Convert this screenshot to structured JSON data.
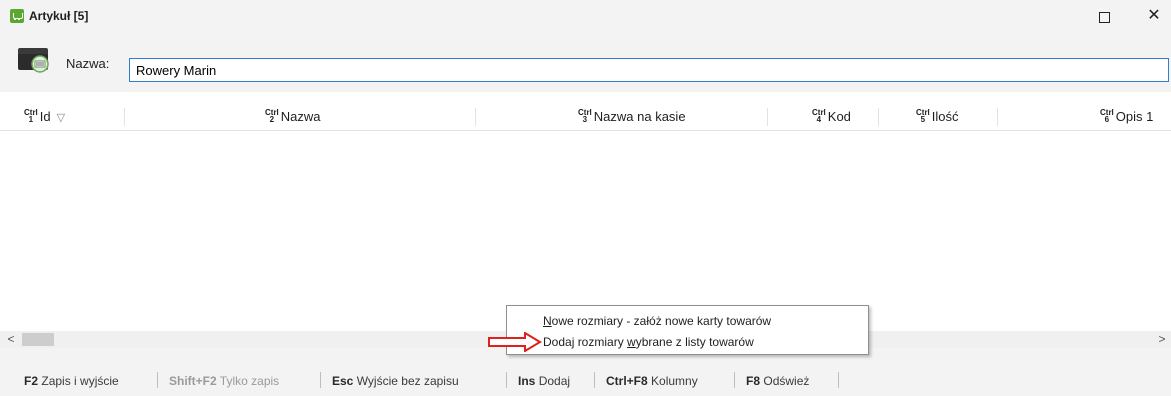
{
  "window": {
    "title": "Artykuł [5]",
    "maximize_icon": "maximize-icon",
    "close_icon": "close-icon",
    "close_glyph": "✕"
  },
  "search": {
    "label": "Nazwa:",
    "value": "Rowery Marin",
    "icon": "product-card-icon"
  },
  "columns": [
    {
      "ctrl": "Ctrl",
      "key": "1",
      "label": "Id"
    },
    {
      "ctrl": "Ctrl",
      "key": "2",
      "label": "Nazwa"
    },
    {
      "ctrl": "Ctrl",
      "key": "3",
      "label": "Nazwa na kasie"
    },
    {
      "ctrl": "Ctrl",
      "key": "4",
      "label": "Kod"
    },
    {
      "ctrl": "Ctrl",
      "key": "5",
      "label": "Ilość"
    },
    {
      "ctrl": "Ctrl",
      "key": "6",
      "label": "Opis 1"
    }
  ],
  "context_menu": {
    "items": [
      {
        "label_pre": "",
        "accel": "N",
        "label_post": "owe rozmiary - załóż nowe karty towarów"
      },
      {
        "label_pre": "Dodaj rozmiary ",
        "accel": "w",
        "label_post": "ybrane z listy towarów"
      }
    ]
  },
  "footer": {
    "actions": [
      {
        "key": "F2",
        "label": "Zapis i wyjście",
        "enabled": true
      },
      {
        "key": "Shift+F2",
        "label": "Tylko zapis",
        "enabled": false
      },
      {
        "key": "Esc",
        "label": "Wyjście bez zapisu",
        "enabled": true
      },
      {
        "key": "Ins",
        "label": "Dodaj",
        "enabled": true
      },
      {
        "key": "Ctrl+F8",
        "label": "Kolumny",
        "enabled": true
      },
      {
        "key": "F8",
        "label": "Odśwież",
        "enabled": true
      }
    ]
  },
  "colors": {
    "accent_blue": "#2f7fd1",
    "icon_green": "#5aa832",
    "annotation_red": "#e0201a",
    "chrome_gray": "#f3f3f3"
  }
}
